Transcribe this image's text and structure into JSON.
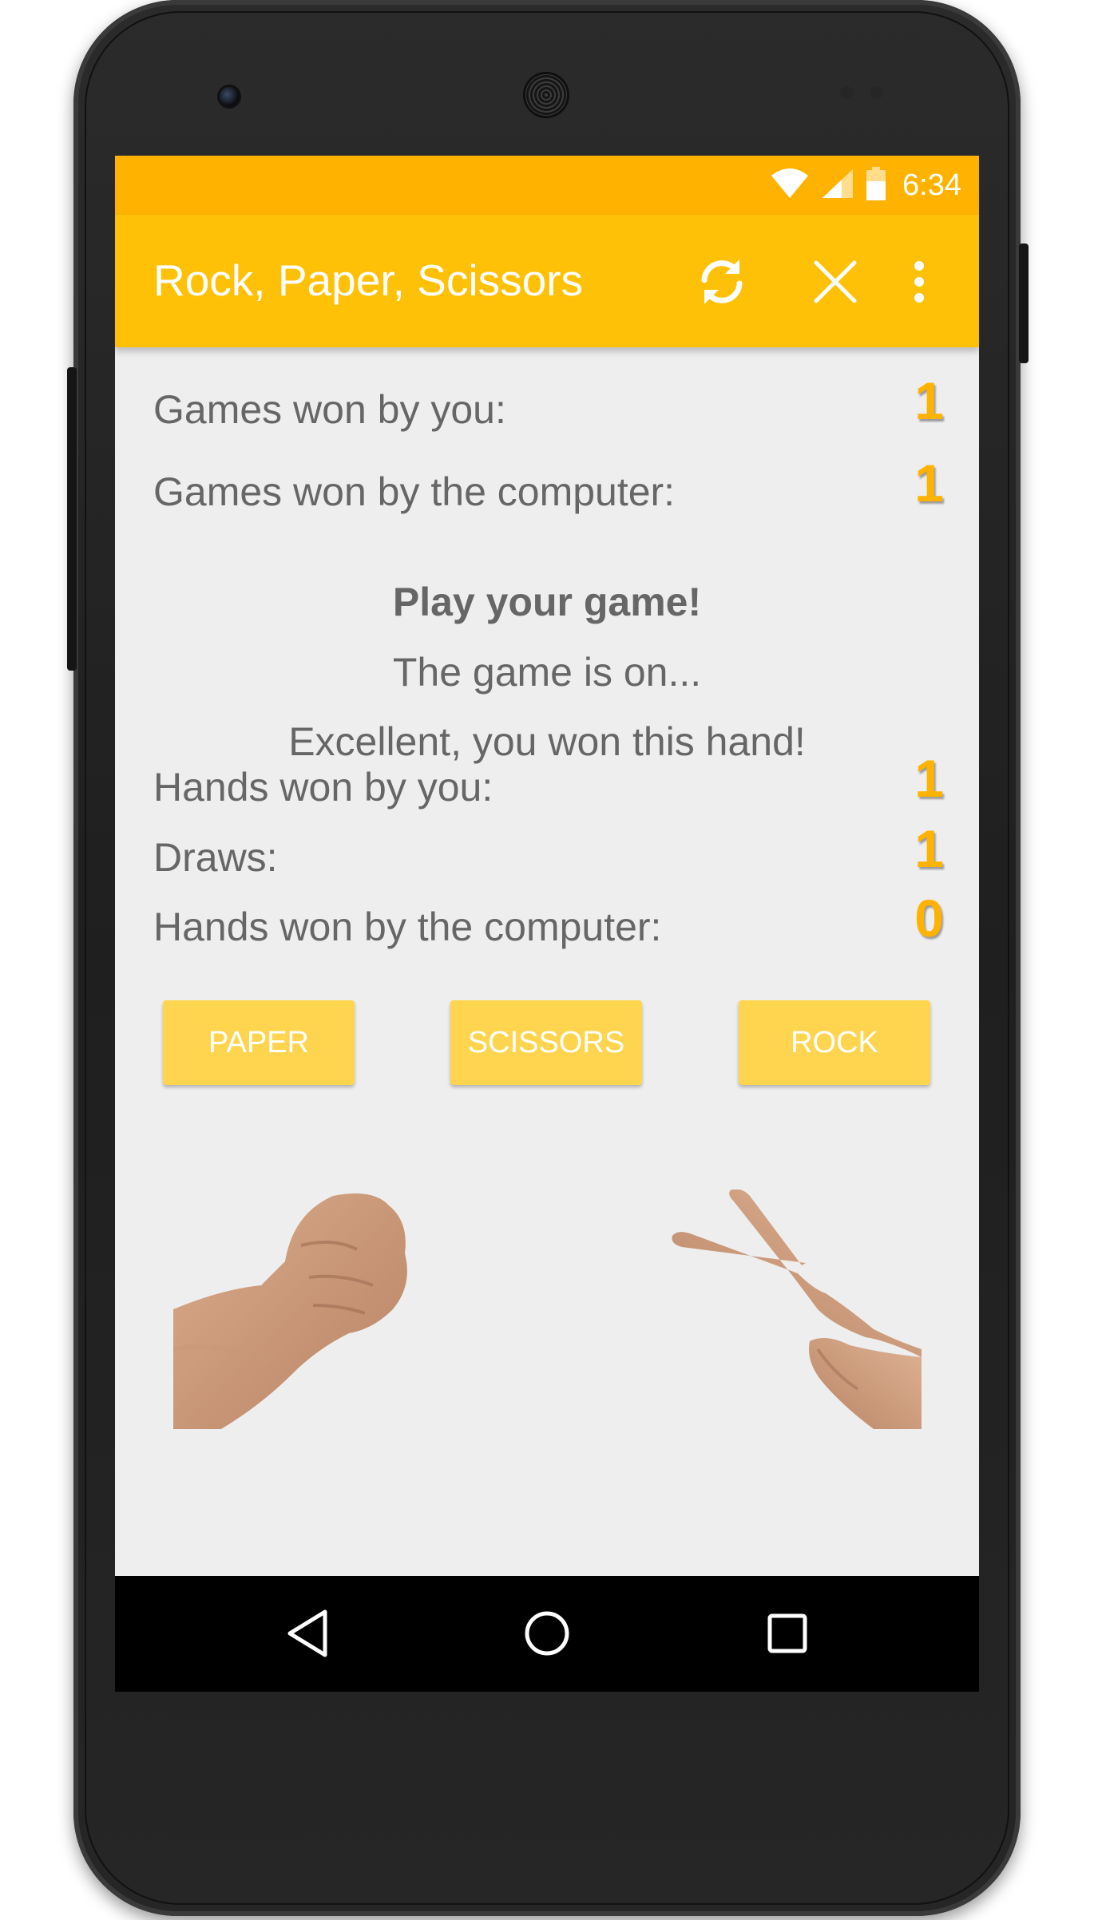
{
  "status_bar": {
    "time": "6:34",
    "icons": [
      "wifi-icon",
      "signal-icon",
      "battery-icon"
    ]
  },
  "app_bar": {
    "title": "Rock, Paper, Scissors",
    "actions": [
      "refresh-icon",
      "close-icon",
      "overflow-menu-icon"
    ]
  },
  "games": {
    "won_by_you_label": "Games won by you:",
    "won_by_you_value": "1",
    "won_by_computer_label": "Games won by the computer:",
    "won_by_computer_value": "1"
  },
  "messages": {
    "prompt": "Play your game!",
    "status": "The game is on...",
    "result": "Excellent, you won this hand!"
  },
  "hands": {
    "won_by_you_label": "Hands won by you:",
    "won_by_you_value": "1",
    "draws_label": "Draws:",
    "draws_value": "1",
    "won_by_computer_label": "Hands won by the computer:",
    "won_by_computer_value": "0"
  },
  "buttons": {
    "paper": "PAPER",
    "scissors": "SCISSORS",
    "rock": "ROCK"
  },
  "images": {
    "left_hand": "rock-fist-hand",
    "right_hand": "scissors-hand"
  },
  "nav_bar": {
    "icons": [
      "back-icon",
      "home-icon",
      "recents-icon"
    ]
  },
  "colors": {
    "status_bar": "#ffb300",
    "app_bar": "#ffc107",
    "accent_value": "#ffb300",
    "button": "#ffd54f",
    "background": "#eeeeee"
  }
}
